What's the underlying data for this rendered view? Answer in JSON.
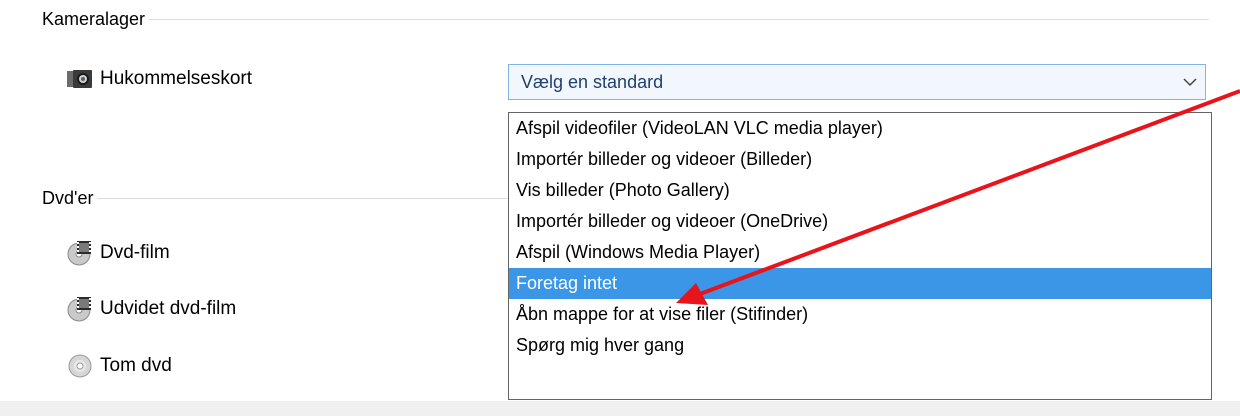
{
  "camera_group": {
    "title": "Kameralager",
    "items": [
      {
        "label": "Hukommelseskort",
        "icon": "memory-card-icon"
      }
    ]
  },
  "dvd_group": {
    "title": "Dvd'er",
    "items": [
      {
        "label": "Dvd-film",
        "icon": "dvd-movie-icon"
      },
      {
        "label": "Udvidet dvd-film",
        "icon": "dvd-movie-icon"
      },
      {
        "label": "Tom dvd",
        "icon": "blank-disc-icon"
      }
    ]
  },
  "combo": {
    "value": "Vælg en standard",
    "icon": "chevron-down-icon"
  },
  "dropdown": {
    "options": [
      "Afspil videofiler (VideoLAN VLC media player)",
      "Importér billeder og videoer (Billeder)",
      "Vis billeder (Photo Gallery)",
      "Importér billeder og videoer (OneDrive)",
      "Afspil (Windows Media Player)",
      "Foretag intet",
      "Åbn mappe for at vise filer (Stifinder)",
      "Spørg mig hver gang"
    ],
    "selected_index": 5
  },
  "annotation": {
    "type": "arrow",
    "color": "#e8141c"
  },
  "colors": {
    "selection": "#3c96e8",
    "combo_border": "#7eb4ea",
    "combo_bg": "#f2f7fd"
  }
}
